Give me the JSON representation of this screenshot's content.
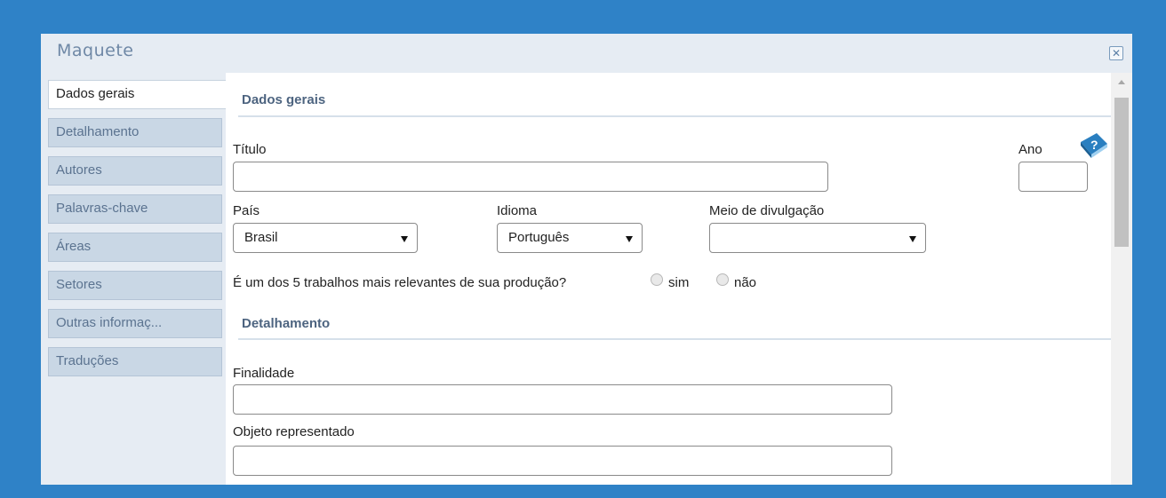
{
  "window": {
    "title": "Maquete"
  },
  "sidebar": {
    "tabs": [
      {
        "label": "Dados gerais",
        "active": true
      },
      {
        "label": "Detalhamento",
        "active": false
      },
      {
        "label": "Autores",
        "active": false
      },
      {
        "label": "Palavras-chave",
        "active": false
      },
      {
        "label": "Áreas",
        "active": false
      },
      {
        "label": "Setores",
        "active": false
      },
      {
        "label": "Outras informaç...",
        "active": false
      },
      {
        "label": "Traduções",
        "active": false
      }
    ]
  },
  "dados_gerais": {
    "section_title": "Dados gerais",
    "titulo": {
      "label": "Título",
      "value": ""
    },
    "ano": {
      "label": "Ano",
      "value": ""
    },
    "pais": {
      "label": "País",
      "selected": "Brasil"
    },
    "idioma": {
      "label": "Idioma",
      "selected": "Português"
    },
    "meio": {
      "label": "Meio de divulgação",
      "selected": ""
    },
    "relevante": {
      "question": "É um dos 5 trabalhos mais relevantes de sua produção?",
      "sim": "sim",
      "nao": "não"
    }
  },
  "detalhamento": {
    "section_title": "Detalhamento",
    "finalidade": {
      "label": "Finalidade",
      "value": ""
    },
    "objeto": {
      "label": "Objeto representado",
      "value": ""
    }
  },
  "icons": {
    "help": "help-book-icon",
    "close": "close-icon"
  },
  "colors": {
    "frame": "#2f82c7",
    "sidebar": "#e6ecf3",
    "tab": "#c9d7e5",
    "section_title": "#4d6480"
  }
}
